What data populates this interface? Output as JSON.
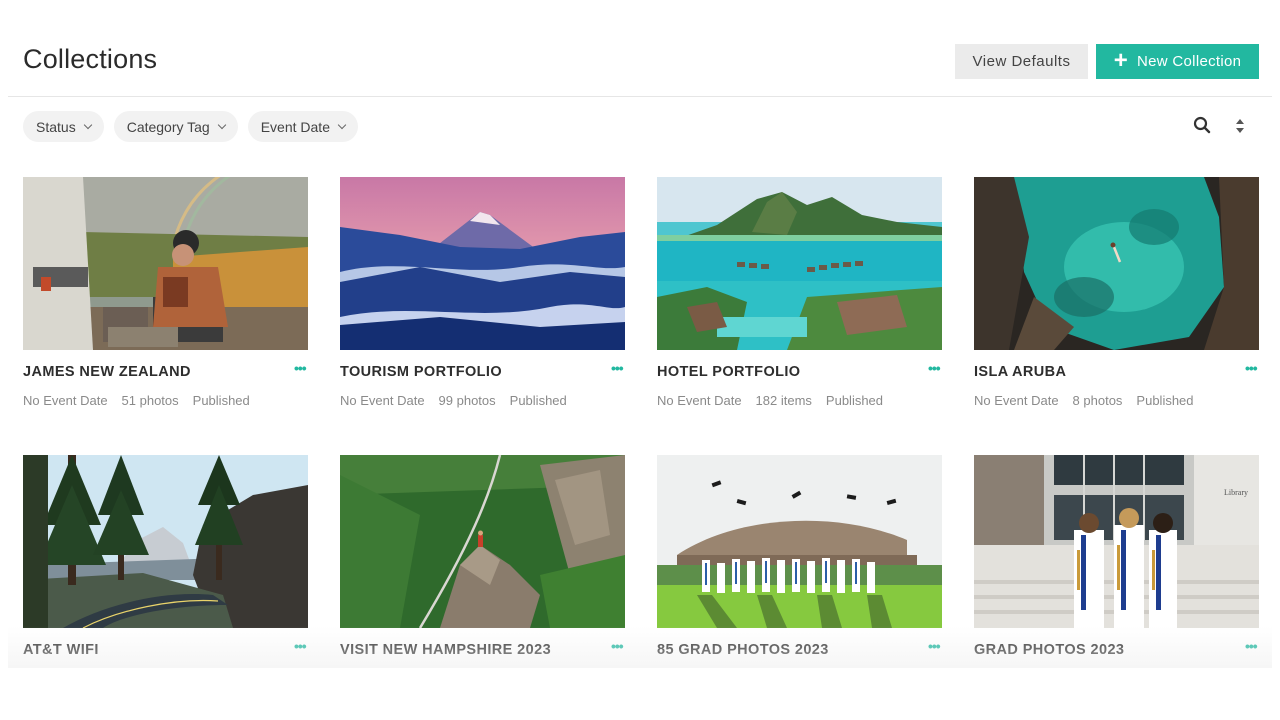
{
  "header": {
    "title": "Collections",
    "view_defaults_label": "View Defaults",
    "new_collection_label": "New Collection",
    "accent_color": "#22b8a0"
  },
  "filters": [
    {
      "label": "Status"
    },
    {
      "label": "Category Tag"
    },
    {
      "label": "Event Date"
    }
  ],
  "toolbar": {
    "search_icon": "search-icon",
    "sort_icon": "sort-icon"
  },
  "collections": [
    {
      "title": "JAMES NEW ZEALAND",
      "event": "No Event Date",
      "count": "51 photos",
      "status": "Published",
      "image": "person-camping-rainbow"
    },
    {
      "title": "TOURISM PORTFOLIO",
      "event": "No Event Date",
      "count": "99 photos",
      "status": "Published",
      "image": "mountain-peak-fog"
    },
    {
      "title": "HOTEL PORTFOLIO",
      "event": "No Event Date",
      "count": "182 items",
      "status": "Published",
      "image": "overwater-bungalows"
    },
    {
      "title": "ISLA ARUBA",
      "event": "No Event Date",
      "count": "8 photos",
      "status": "Published",
      "image": "swimmer-natural-pool"
    },
    {
      "title": "AT&T WIFI",
      "event": "",
      "count": "",
      "status": "",
      "image": "forest-road-granite-dome"
    },
    {
      "title": "VISIT NEW HAMPSHIRE 2023",
      "event": "",
      "count": "",
      "status": "",
      "image": "cliff-valley-aerial"
    },
    {
      "title": "85 GRAD PHOTOS 2023",
      "event": "",
      "count": "",
      "status": "",
      "image": "graduates-throwing-caps"
    },
    {
      "title": "GRAD PHOTOS 2023",
      "event": "",
      "count": "",
      "status": "",
      "image": "graduates-library"
    }
  ],
  "thumbnail_sign_text": "Library"
}
